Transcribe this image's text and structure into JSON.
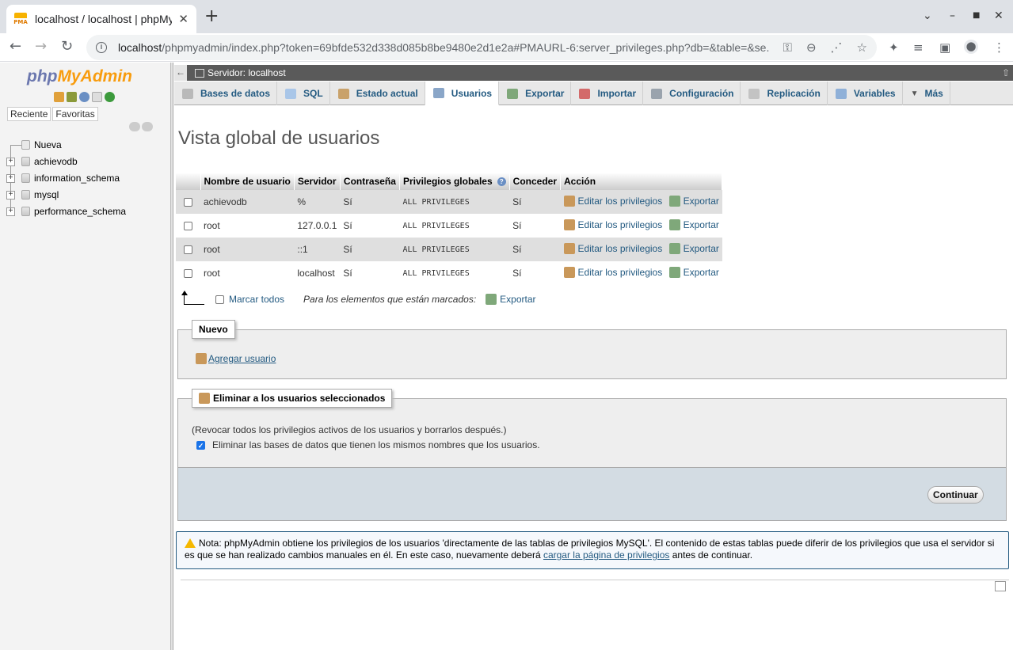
{
  "browser": {
    "tab_title": "localhost / localhost | phpMyAdmin",
    "favicon_text": "PMA",
    "url_host": "localhost",
    "url_path": "/phpmyadmin/index.php?token=69bfde532d338d085b8be9480e2d1e2a#PMAURL-6:server_privileges.php?db=&table=&se..."
  },
  "leftnav": {
    "logo_php": "php",
    "logo_myadmin": "MyAdmin",
    "tab_recent": "Reciente",
    "tab_favorites": "Favoritas",
    "tree": [
      {
        "label": "Nueva"
      },
      {
        "label": "achievodb"
      },
      {
        "label": "information_schema"
      },
      {
        "label": "mysql"
      },
      {
        "label": "performance_schema"
      }
    ]
  },
  "server_bar": {
    "back": "←",
    "label": "Servidor: localhost"
  },
  "menu": [
    {
      "label": "Bases de datos",
      "icon": "database-icon",
      "color": "#b9b9b9"
    },
    {
      "label": "SQL",
      "icon": "sql-icon",
      "color": "#a9c6e8"
    },
    {
      "label": "Estado actual",
      "icon": "status-chart-icon",
      "color": "#c9a26b"
    },
    {
      "label": "Usuarios",
      "icon": "users-icon",
      "color": "#8aa6c8"
    },
    {
      "label": "Exportar",
      "icon": "export-icon",
      "color": "#7fa87a"
    },
    {
      "label": "Importar",
      "icon": "import-icon",
      "color": "#d36a6a"
    },
    {
      "label": "Configuración",
      "icon": "wrench-icon",
      "color": "#9aa3ad"
    },
    {
      "label": "Replicación",
      "icon": "replication-icon",
      "color": "#c3c3c3"
    },
    {
      "label": "Variables",
      "icon": "variables-icon",
      "color": "#8fb0d8"
    },
    {
      "label": "Más",
      "icon": "chevron-down-icon",
      "color": "#555555"
    }
  ],
  "page": {
    "title": "Vista global de usuarios"
  },
  "table": {
    "headers": [
      "Nombre de usuario",
      "Servidor",
      "Contraseña",
      "Privilegios globales",
      "Conceder",
      "Acción"
    ],
    "rows": [
      {
        "user": "achievodb",
        "host": "%",
        "password": "Sí",
        "privileges": "ALL PRIVILEGES",
        "grant": "Sí",
        "edit": "Editar los privilegios",
        "export": "Exportar"
      },
      {
        "user": "root",
        "host": "127.0.0.1",
        "password": "Sí",
        "privileges": "ALL PRIVILEGES",
        "grant": "Sí",
        "edit": "Editar los privilegios",
        "export": "Exportar"
      },
      {
        "user": "root",
        "host": "::1",
        "password": "Sí",
        "privileges": "ALL PRIVILEGES",
        "grant": "Sí",
        "edit": "Editar los privilegios",
        "export": "Exportar"
      },
      {
        "user": "root",
        "host": "localhost",
        "password": "Sí",
        "privileges": "ALL PRIVILEGES",
        "grant": "Sí",
        "edit": "Editar los privilegios",
        "export": "Exportar"
      }
    ]
  },
  "with_selected": {
    "check_all": "Marcar todos",
    "label": "Para los elementos que están marcados:",
    "export": "Exportar"
  },
  "new_box": {
    "legend": "Nuevo",
    "add_user": "Agregar usuario"
  },
  "delete_box": {
    "legend": "Eliminar a los usuarios seleccionados",
    "description": "(Revocar todos los privilegios activos de los usuarios y borrarlos después.)",
    "drop_db_label": "Eliminar las bases de datos que tienen los mismos nombres que los usuarios.",
    "drop_db_checked": true,
    "continue": "Continuar"
  },
  "notice": {
    "text_before": "Nota: phpMyAdmin obtiene los privilegios de los usuarios 'directamente de las tablas de privilegios MySQL'. El contenido de estas tablas puede diferir de los privilegios que usa el servidor si es que se han realizado cambios manuales en él. En este caso, nuevamente deberá ",
    "link": "cargar la página de privilegios",
    "text_after": " antes de continuar."
  }
}
